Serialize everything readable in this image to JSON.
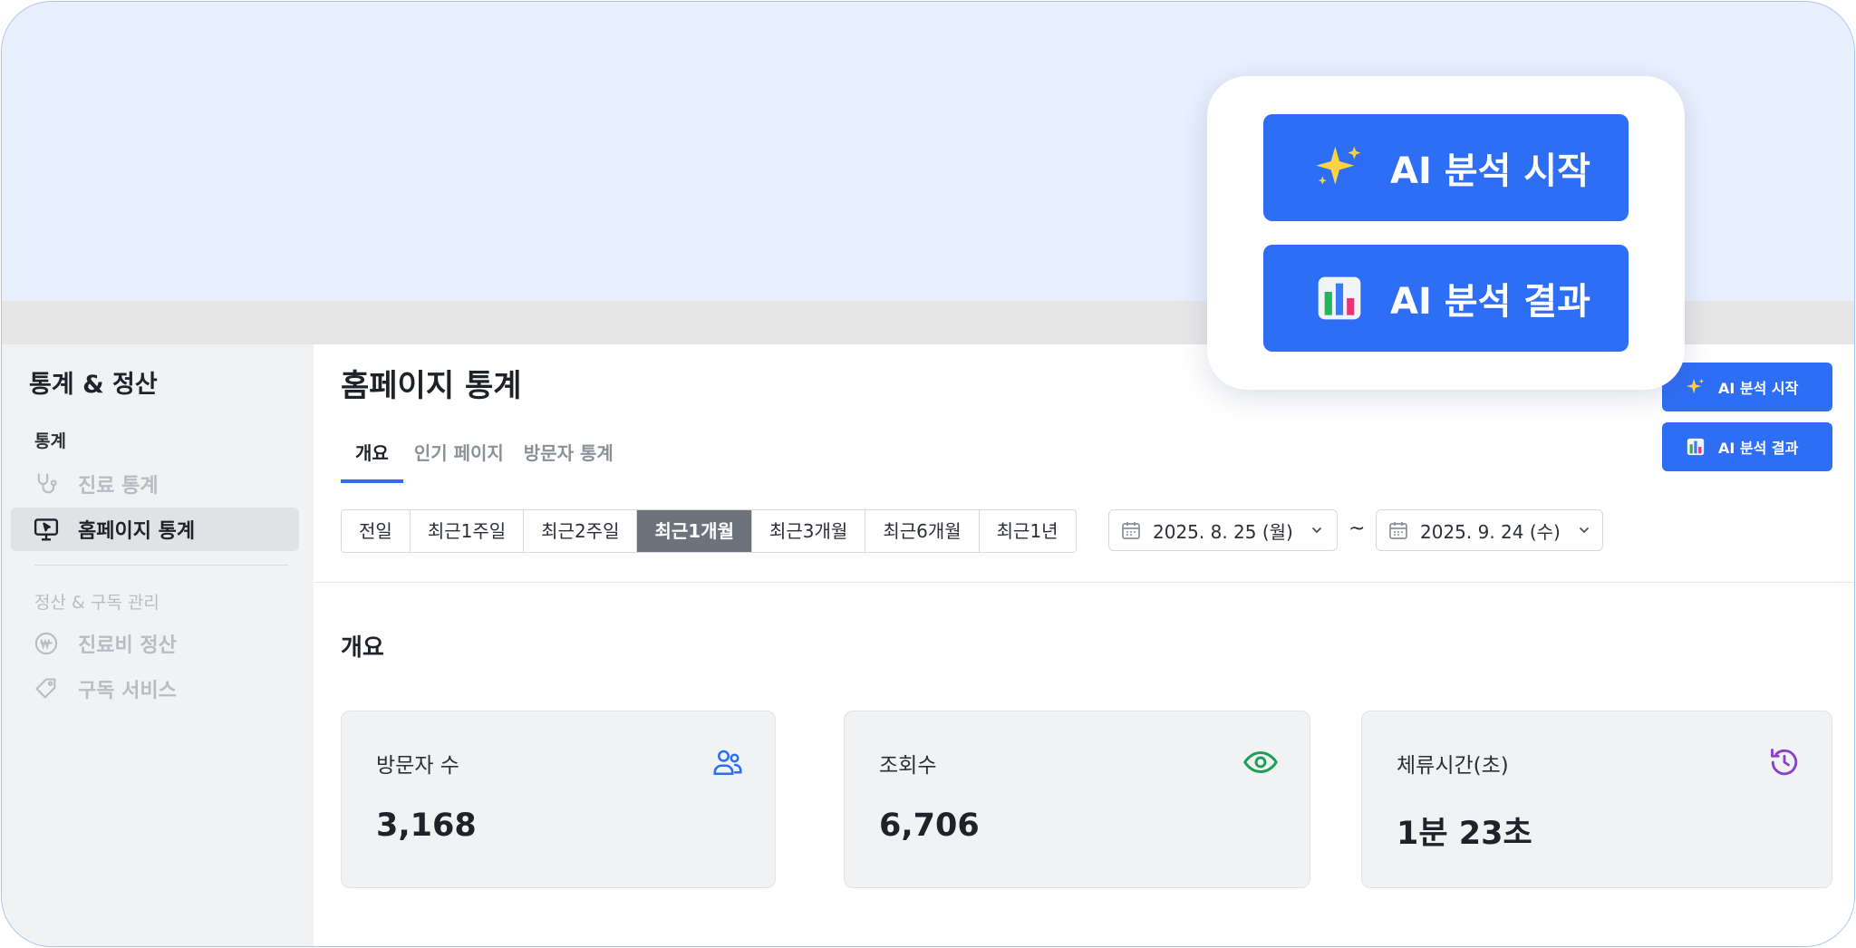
{
  "sidebar": {
    "title": "통계 & 정산",
    "sections": [
      {
        "label": "통계",
        "items": [
          {
            "label": "진료 통계",
            "icon": "stethoscope-icon",
            "state": "disabled"
          },
          {
            "label": "홈페이지 통계",
            "icon": "monitor-cursor-icon",
            "state": "active"
          }
        ]
      },
      {
        "label": "정산 & 구독 관리",
        "items": [
          {
            "label": "진료비 정산",
            "icon": "won-coin-icon",
            "state": "disabled"
          },
          {
            "label": "구독 서비스",
            "icon": "tag-icon",
            "state": "disabled"
          }
        ]
      }
    ]
  },
  "main": {
    "title": "홈페이지 통계",
    "tabs": [
      {
        "label": "개요",
        "active": true
      },
      {
        "label": "인기 페이지",
        "active": false
      },
      {
        "label": "방문자 통계",
        "active": false
      }
    ],
    "periods": [
      "전일",
      "최근1주일",
      "최근2주일",
      "최근1개월",
      "최근3개월",
      "최근6개월",
      "최근1년"
    ],
    "active_period": "최근1개월",
    "date_from": "2025. 8. 25 (월)",
    "date_separator": "~",
    "date_to": "2025. 9. 24 (수)",
    "section_title": "개요",
    "cards": [
      {
        "label": "방문자 수",
        "value": "3,168",
        "icon": "users-icon",
        "icon_color": "#2e6ef5"
      },
      {
        "label": "조회수",
        "value": "6,706",
        "icon": "eye-icon",
        "icon_color": "#1f9e57"
      },
      {
        "label": "체류시간(초)",
        "value": "1분 23초",
        "icon": "history-icon",
        "icon_color": "#8a3fd1"
      }
    ]
  },
  "ai_buttons": {
    "start_label": "AI 분석 시작",
    "start_icon": "sparkles-icon",
    "result_label": "AI 분석 결과",
    "result_icon": "bar-chart-icon"
  },
  "colors": {
    "accent": "#2e6ef5",
    "hero_bg": "#e8effd",
    "sidebar_bg": "#f1f2f4",
    "active_period_bg": "#6c737d"
  }
}
